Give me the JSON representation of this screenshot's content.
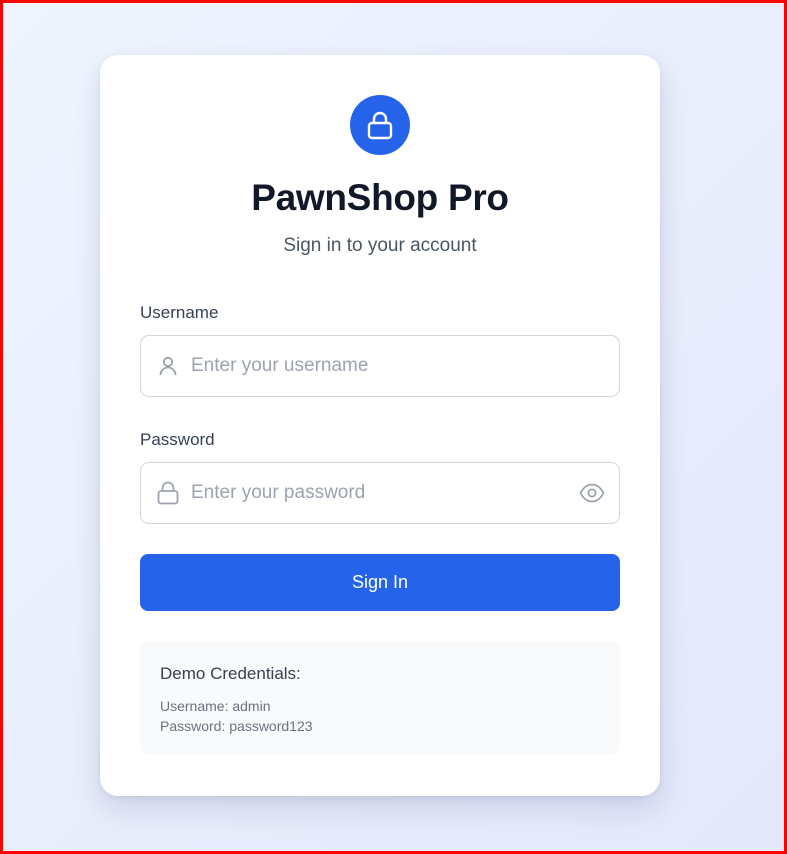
{
  "app": {
    "title": "PawnShop Pro",
    "subtitle": "Sign in to your account"
  },
  "form": {
    "username": {
      "label": "Username",
      "value": "",
      "placeholder": "Enter your username",
      "icon": "user-icon"
    },
    "password": {
      "label": "Password",
      "value": "",
      "placeholder": "Enter your password",
      "icon": "lock-icon",
      "toggle_icon": "eye-icon"
    },
    "submit_label": "Sign In"
  },
  "demo": {
    "title": "Demo Credentials:",
    "username_line": "Username: admin",
    "password_line": "Password: password123"
  },
  "colors": {
    "accent": "#2563eb",
    "frame": "#ff0000"
  }
}
